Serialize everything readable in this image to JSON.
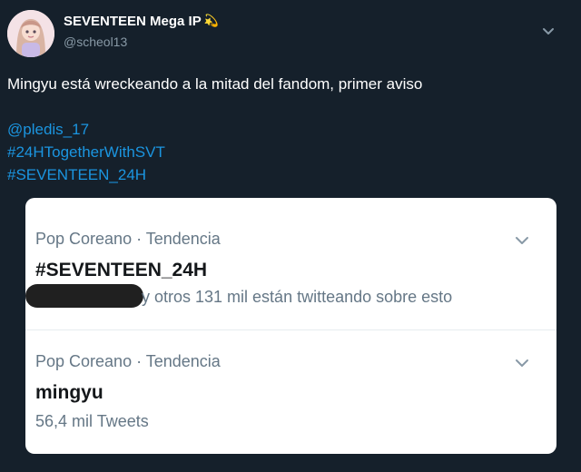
{
  "tweet": {
    "author_name": "SEVENTEEN Mega IP",
    "author_emoji": "💫",
    "author_handle": "@scheol13",
    "text": "Mingyu está wreckeando a la mitad del fandom, primer aviso",
    "links": [
      "@pledis_17",
      "#24HTogetherWithSVT",
      "#SEVENTEEN_24H"
    ]
  },
  "trends": [
    {
      "context": "Pop Coreano · Tendencia",
      "title": "#SEVENTEEN_24H",
      "meta": "y otros 131 mil están twitteando sobre esto"
    },
    {
      "context": "Pop Coreano · Tendencia",
      "title": "mingyu",
      "meta": "56,4 mil Tweets"
    }
  ],
  "colors": {
    "background": "#15202b",
    "link": "#1b95e0",
    "card": "#ffffff",
    "muted": "#657786"
  }
}
